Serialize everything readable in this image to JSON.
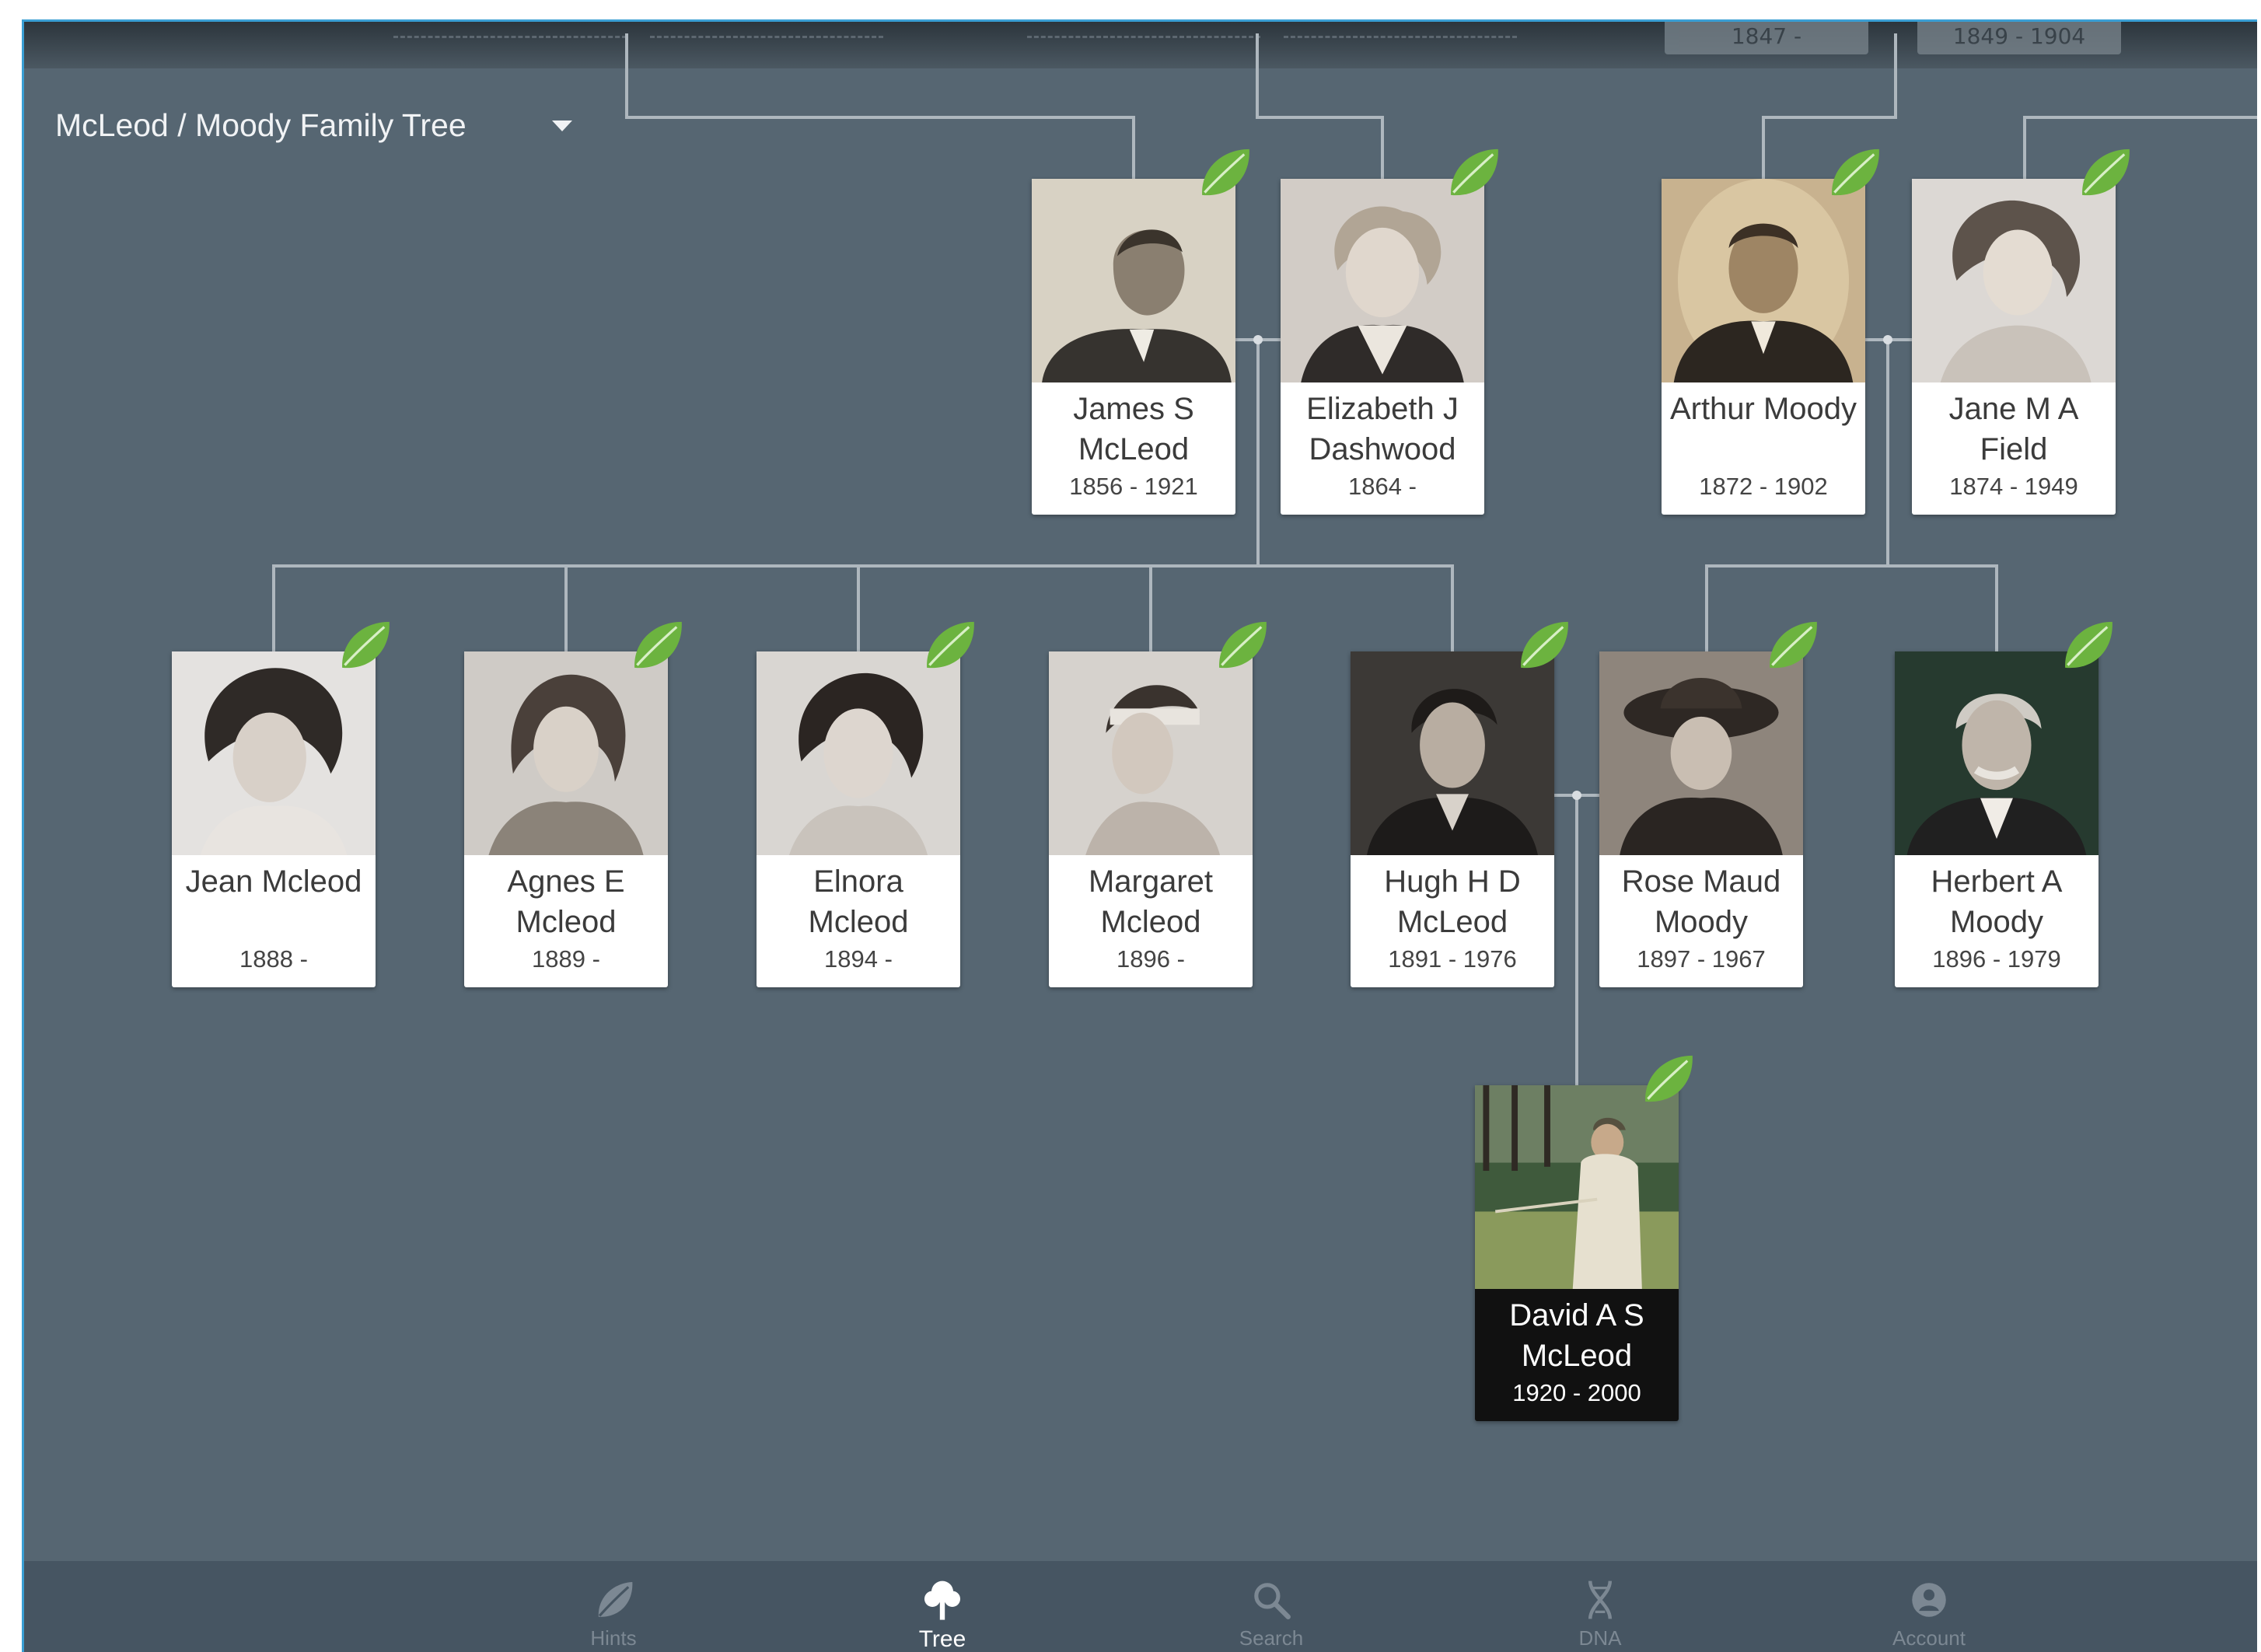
{
  "app": {
    "tree_selector": {
      "label": "McLeod / Moody Family Tree"
    },
    "ghost_top": [
      "1847 -",
      "1849 - 1904"
    ]
  },
  "people": {
    "james": {
      "name": "James S McLeod",
      "years": "1856 - 1921"
    },
    "elizabeth": {
      "name": "Elizabeth J Dashwood",
      "years": "1864 -"
    },
    "arthur": {
      "name": "Arthur Moody",
      "years": "1872 - 1902"
    },
    "jane": {
      "name": "Jane M A Field",
      "years": "1874 - 1949"
    },
    "jean": {
      "name": "Jean Mcleod",
      "years": "1888 -"
    },
    "agnes": {
      "name": "Agnes E Mcleod",
      "years": "1889 -"
    },
    "elnora": {
      "name": "Elnora Mcleod",
      "years": "1894 -"
    },
    "margaret": {
      "name": "Margaret Mcleod",
      "years": "1896 -"
    },
    "hugh": {
      "name": "Hugh H D McLeod",
      "years": "1891 - 1976"
    },
    "rose": {
      "name": "Rose Maud Moody",
      "years": "1897 - 1967"
    },
    "herbert": {
      "name": "Herbert A Moody",
      "years": "1896 - 1979"
    },
    "david": {
      "name": "David A S McLeod",
      "years": "1920 - 2000"
    }
  },
  "nav": {
    "hints": {
      "label": "Hints",
      "icon": "leaf-icon"
    },
    "tree": {
      "label": "Tree",
      "icon": "tree-icon"
    },
    "search": {
      "label": "Search",
      "icon": "search-icon"
    },
    "dna": {
      "label": "DNA",
      "icon": "dna-icon"
    },
    "account": {
      "label": "Account",
      "icon": "account-icon"
    }
  },
  "colors": {
    "canvas": "#566672",
    "navbar": "#465562",
    "leaf": "#6cb33f",
    "accent_border": "#3a9fd4"
  }
}
